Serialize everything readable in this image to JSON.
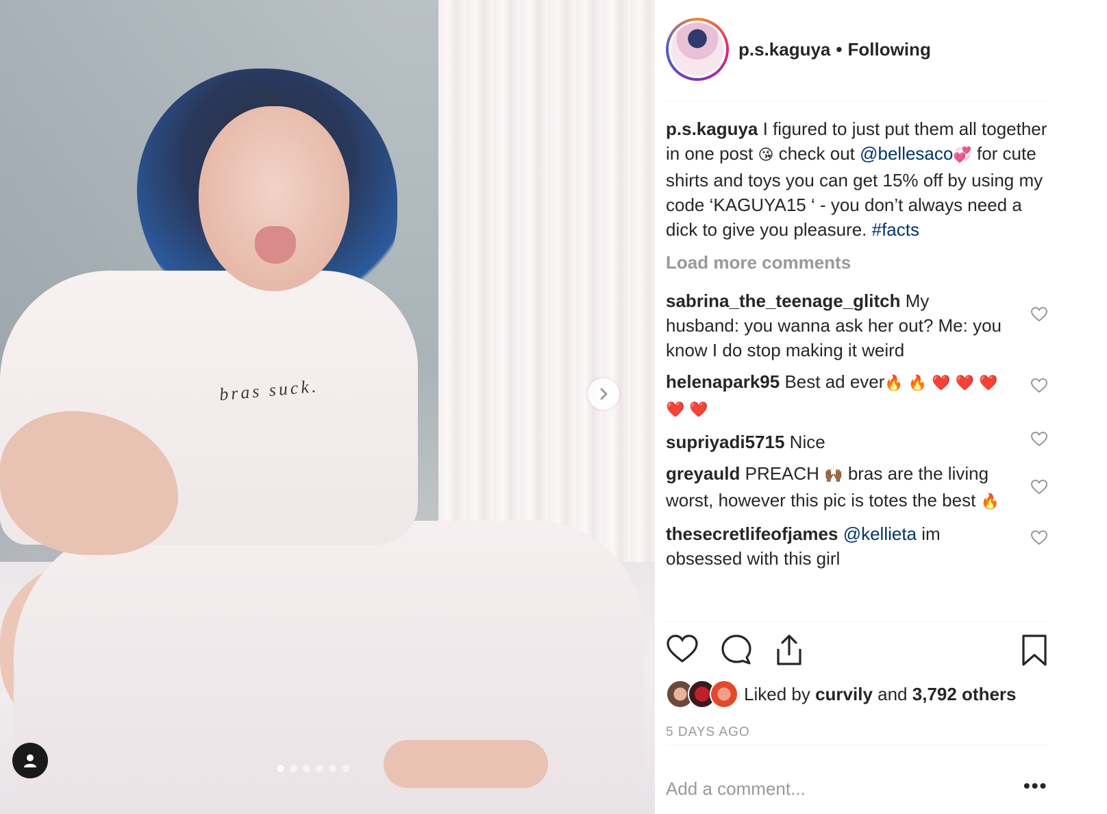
{
  "post": {
    "shirt_text": "bras suck.",
    "carousel_dot_count": 6,
    "carousel_active_index": 0
  },
  "header": {
    "username": "p.s.kaguya",
    "separator": "•",
    "follow_status": "Following"
  },
  "caption": {
    "username": "p.s.kaguya",
    "text1": " I figured to just put them all together in one post ",
    "emoji1": "😘",
    "text2": "  check out ",
    "mention": "@bellesaco",
    "emoji2": "💞",
    "text3": "  for cute shirts and toys you can get 15% off by using my code ‘KAGUYA15 ‘ - you don’t always need a dick to give you pleasure. ",
    "hashtag": "#facts"
  },
  "load_more": "Load more comments",
  "comments": [
    {
      "username": "sabrina_the_teenage_glitch",
      "text": " My husband: you wanna ask her out? Me: you know I do stop making it weird"
    },
    {
      "username": "helenapark95",
      "text": " Best ad ever",
      "emojis": "🔥 🔥 ❤️ ❤️ ❤️ ❤️ ❤️"
    },
    {
      "username": "supriyadi5715",
      "text": " Nice"
    },
    {
      "username": "greyauld",
      "text1": " PREACH ",
      "emoji": "🙌🏾",
      "text2": "  bras are the living worst, however this pic is totes the best ",
      "emoji2": "🔥"
    },
    {
      "username": "thesecretlifeofjames",
      "mention": "@kellieta",
      "text": " im obsessed with this girl"
    }
  ],
  "likes": {
    "prefix": "Liked by ",
    "user": "curvily",
    "middle": " and ",
    "count": "3,792 others"
  },
  "timestamp": "5 DAYS AGO",
  "add_comment_placeholder": "Add a comment...",
  "more_label": "•••",
  "icons": {
    "like": "heart-icon",
    "comment": "comment-icon",
    "share": "share-icon",
    "save": "bookmark-icon",
    "next": "chevron-right-icon",
    "tag": "user-tag-icon",
    "comment_like": "small-heart-icon"
  }
}
